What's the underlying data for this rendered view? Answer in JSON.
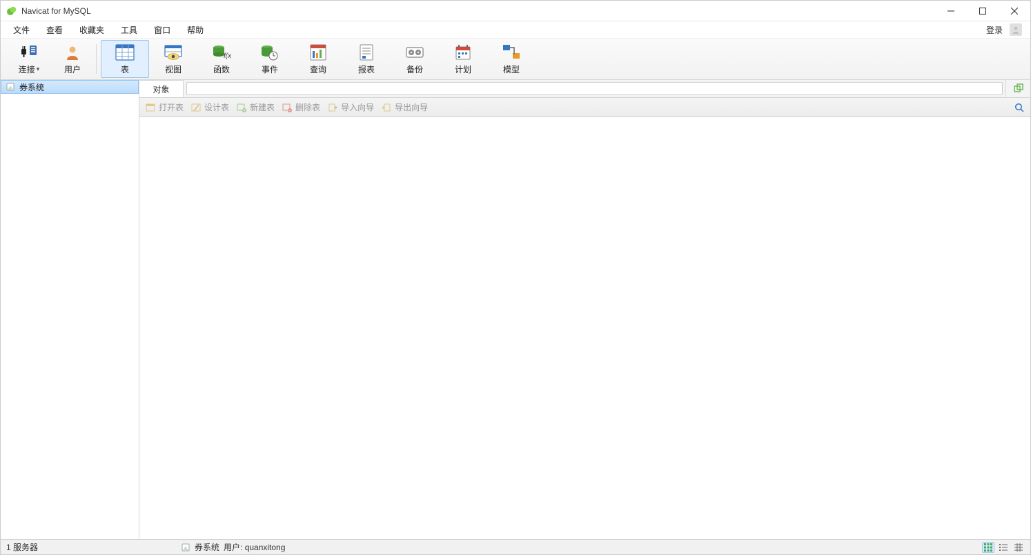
{
  "app": {
    "title": "Navicat for MySQL"
  },
  "menu": {
    "items": [
      "文件",
      "查看",
      "收藏夹",
      "工具",
      "窗口",
      "帮助"
    ],
    "login": "登录"
  },
  "toolbar": {
    "connect": "连接",
    "user": "用户",
    "table": "表",
    "view": "视图",
    "function": "函数",
    "event": "事件",
    "query": "查询",
    "report": "报表",
    "backup": "备份",
    "schedule": "计划",
    "model": "模型"
  },
  "sidebar": {
    "connection_name": "券系统"
  },
  "tabs": {
    "objects": "对象"
  },
  "subtoolbar": {
    "open_table": "打开表",
    "design_table": "设计表",
    "new_table": "新建表",
    "delete_table": "删除表",
    "import_wizard": "导入向导",
    "export_wizard": "导出向导"
  },
  "status": {
    "server_count": "1 服务器",
    "connection": "券系统",
    "user_label": "用户: ",
    "user_value": "quanxitong"
  }
}
